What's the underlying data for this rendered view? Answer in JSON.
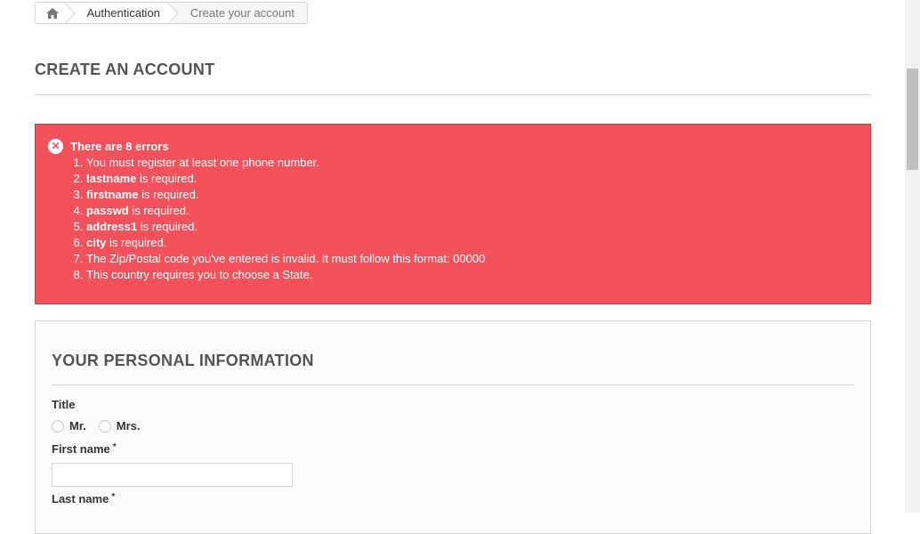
{
  "breadcrumb": {
    "home_icon": "home-icon",
    "items": [
      "Authentication",
      "Create your account"
    ]
  },
  "page_heading": "CREATE AN ACCOUNT",
  "alert": {
    "icon": "close-circle-icon",
    "title": "There are 8 errors",
    "errors": [
      {
        "bold": "",
        "text": "You must register at least one phone number."
      },
      {
        "bold": "lastname",
        "text": " is required."
      },
      {
        "bold": "firstname",
        "text": " is required."
      },
      {
        "bold": "passwd",
        "text": " is required."
      },
      {
        "bold": "address1",
        "text": " is required."
      },
      {
        "bold": "city",
        "text": " is required."
      },
      {
        "bold": "",
        "text": "The Zip/Postal code you've entered is invalid. It must follow this format: 00000"
      },
      {
        "bold": "",
        "text": "This country requires you to choose a State."
      }
    ],
    "background_color": "#f3515c"
  },
  "form": {
    "section_heading": "YOUR PERSONAL INFORMATION",
    "title_label": "Title",
    "title_options": [
      "Mr.",
      "Mrs."
    ],
    "first_name_label": "First name",
    "last_name_label": "Last name",
    "required_mark": "*",
    "first_name_value": ""
  }
}
